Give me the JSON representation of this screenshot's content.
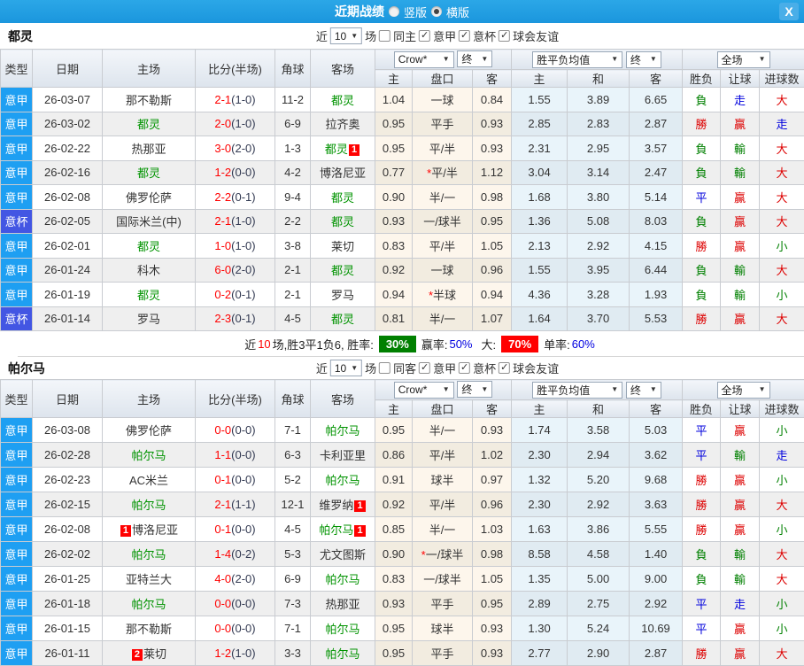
{
  "titlebar": {
    "title": "近期战绩",
    "radio_vertical": "竖版",
    "radio_horizontal": "横版"
  },
  "icons": {
    "arrow": "▼",
    "check": "✓",
    "close": "X"
  },
  "colors": {
    "titlebar_blue": "#1d9ce1",
    "league_badge": "#1e9ff2",
    "cup_badge": "#4356e3",
    "focal_team_green": "#009300",
    "score_red": "#ff0000",
    "win_red": "#dd0000",
    "draw_blue": "#0000dd",
    "lose_green": "#008000",
    "rate_green_bg": "#008000",
    "rate_red_bg": "#ff0000",
    "handicap_col_bg": "#fdf6ec",
    "avg_col_bg": "#e9f4fa"
  },
  "header_labels": {
    "type": "类型",
    "date": "日期",
    "home": "主场",
    "score": "比分(半场)",
    "corner": "角球",
    "away": "客场",
    "h": "主",
    "pan": "盘口",
    "a": "客",
    "h2": "主",
    "d": "和",
    "a2": "客",
    "result": "胜负",
    "let": "让球",
    "goals": "进球数",
    "crow": "Crow*",
    "final": "终",
    "avg": "胜平负均值",
    "final2": "终",
    "scope": "全场"
  },
  "sections": [
    {
      "team": "都灵",
      "filters": {
        "near": "近",
        "count": "10",
        "games": "场",
        "same": "同主",
        "c1": "意甲",
        "c2": "意杯",
        "c3": "球会友谊"
      },
      "rows": [
        {
          "lg": "意甲",
          "date": "26-03-07",
          "home": "那不勒斯",
          "hg": false,
          "hb": "",
          "hbp": "",
          "score": "2-1",
          "half": "(1-0)",
          "corner": "11-2",
          "away": "都灵",
          "ag": true,
          "ab": "",
          "o1": "1.04",
          "star": false,
          "pan": "一球",
          "o2": "0.84",
          "m1": "1.55",
          "m2": "3.89",
          "m3": "6.65",
          "r1": "負",
          "r2": "走",
          "r3": "大"
        },
        {
          "lg": "意甲",
          "date": "26-03-02",
          "home": "都灵",
          "hg": true,
          "hb": "",
          "hbp": "",
          "score": "2-0",
          "half": "(1-0)",
          "corner": "6-9",
          "away": "拉齐奥",
          "ag": false,
          "ab": "",
          "o1": "0.95",
          "star": false,
          "pan": "平手",
          "o2": "0.93",
          "m1": "2.85",
          "m2": "2.83",
          "m3": "2.87",
          "r1": "勝",
          "r2": "贏",
          "r3": "走"
        },
        {
          "lg": "意甲",
          "date": "26-02-22",
          "home": "热那亚",
          "hg": false,
          "hb": "",
          "hbp": "",
          "score": "3-0",
          "half": "(2-0)",
          "corner": "1-3",
          "away": "都灵",
          "ag": true,
          "ab": "1",
          "o1": "0.95",
          "star": false,
          "pan": "平/半",
          "o2": "0.93",
          "m1": "2.31",
          "m2": "2.95",
          "m3": "3.57",
          "r1": "負",
          "r2": "輸",
          "r3": "大"
        },
        {
          "lg": "意甲",
          "date": "26-02-16",
          "home": "都灵",
          "hg": true,
          "hb": "",
          "hbp": "",
          "score": "1-2",
          "half": "(0-0)",
          "corner": "4-2",
          "away": "博洛尼亚",
          "ag": false,
          "ab": "",
          "o1": "0.77",
          "star": true,
          "pan": "平/半",
          "o2": "1.12",
          "m1": "3.04",
          "m2": "3.14",
          "m3": "2.47",
          "r1": "負",
          "r2": "輸",
          "r3": "大"
        },
        {
          "lg": "意甲",
          "date": "26-02-08",
          "home": "佛罗伦萨",
          "hg": false,
          "hb": "",
          "hbp": "",
          "score": "2-2",
          "half": "(0-1)",
          "corner": "9-4",
          "away": "都灵",
          "ag": true,
          "ab": "",
          "o1": "0.90",
          "star": false,
          "pan": "半/一",
          "o2": "0.98",
          "m1": "1.68",
          "m2": "3.80",
          "m3": "5.14",
          "r1": "平",
          "r2": "贏",
          "r3": "大"
        },
        {
          "lg": "意杯",
          "date": "26-02-05",
          "home": "国际米兰(中)",
          "hg": false,
          "hb": "",
          "hbp": "",
          "score": "2-1",
          "half": "(1-0)",
          "corner": "2-2",
          "away": "都灵",
          "ag": true,
          "ab": "",
          "o1": "0.93",
          "star": false,
          "pan": "一/球半",
          "o2": "0.95",
          "m1": "1.36",
          "m2": "5.08",
          "m3": "8.03",
          "r1": "負",
          "r2": "贏",
          "r3": "大"
        },
        {
          "lg": "意甲",
          "date": "26-02-01",
          "home": "都灵",
          "hg": true,
          "hb": "",
          "hbp": "",
          "score": "1-0",
          "half": "(1-0)",
          "corner": "3-8",
          "away": "莱切",
          "ag": false,
          "ab": "",
          "o1": "0.83",
          "star": false,
          "pan": "平/半",
          "o2": "1.05",
          "m1": "2.13",
          "m2": "2.92",
          "m3": "4.15",
          "r1": "勝",
          "r2": "贏",
          "r3": "小"
        },
        {
          "lg": "意甲",
          "date": "26-01-24",
          "home": "科木",
          "hg": false,
          "hb": "",
          "hbp": "",
          "score": "6-0",
          "half": "(2-0)",
          "corner": "2-1",
          "away": "都灵",
          "ag": true,
          "ab": "",
          "o1": "0.92",
          "star": false,
          "pan": "一球",
          "o2": "0.96",
          "m1": "1.55",
          "m2": "3.95",
          "m3": "6.44",
          "r1": "負",
          "r2": "輸",
          "r3": "大"
        },
        {
          "lg": "意甲",
          "date": "26-01-19",
          "home": "都灵",
          "hg": true,
          "hb": "",
          "hbp": "",
          "score": "0-2",
          "half": "(0-1)",
          "corner": "2-1",
          "away": "罗马",
          "ag": false,
          "ab": "",
          "o1": "0.94",
          "star": true,
          "pan": "半球",
          "o2": "0.94",
          "m1": "4.36",
          "m2": "3.28",
          "m3": "1.93",
          "r1": "負",
          "r2": "輸",
          "r3": "小"
        },
        {
          "lg": "意杯",
          "date": "26-01-14",
          "home": "罗马",
          "hg": false,
          "hb": "",
          "hbp": "",
          "score": "2-3",
          "half": "(0-1)",
          "corner": "4-5",
          "away": "都灵",
          "ag": true,
          "ab": "",
          "o1": "0.81",
          "star": false,
          "pan": "半/一",
          "o2": "1.07",
          "m1": "1.64",
          "m2": "3.70",
          "m3": "5.53",
          "r1": "勝",
          "r2": "贏",
          "r3": "大"
        }
      ],
      "summary": {
        "t1": "近",
        "n1": "10",
        "t2": "场,胜3平1负6, 胜率:",
        "v1": "30%",
        "t3": "赢率:",
        "v2": "50%",
        "t4": "大:",
        "v3": "70%",
        "t5": "单率:",
        "v4": "60%"
      }
    },
    {
      "team": "帕尔马",
      "filters": {
        "near": "近",
        "count": "10",
        "games": "场",
        "same": "同客",
        "c1": "意甲",
        "c2": "意杯",
        "c3": "球会友谊"
      },
      "rows": [
        {
          "lg": "意甲",
          "date": "26-03-08",
          "home": "佛罗伦萨",
          "hg": false,
          "hb": "",
          "hbp": "",
          "score": "0-0",
          "half": "(0-0)",
          "corner": "7-1",
          "away": "帕尔马",
          "ag": true,
          "ab": "",
          "o1": "0.95",
          "star": false,
          "pan": "半/一",
          "o2": "0.93",
          "m1": "1.74",
          "m2": "3.58",
          "m3": "5.03",
          "r1": "平",
          "r2": "贏",
          "r3": "小"
        },
        {
          "lg": "意甲",
          "date": "26-02-28",
          "home": "帕尔马",
          "hg": true,
          "hb": "",
          "hbp": "",
          "score": "1-1",
          "half": "(0-0)",
          "corner": "6-3",
          "away": "卡利亚里",
          "ag": false,
          "ab": "",
          "o1": "0.86",
          "star": false,
          "pan": "平/半",
          "o2": "1.02",
          "m1": "2.30",
          "m2": "2.94",
          "m3": "3.62",
          "r1": "平",
          "r2": "輸",
          "r3": "走"
        },
        {
          "lg": "意甲",
          "date": "26-02-23",
          "home": "AC米兰",
          "hg": false,
          "hb": "",
          "hbp": "",
          "score": "0-1",
          "half": "(0-0)",
          "corner": "5-2",
          "away": "帕尔马",
          "ag": true,
          "ab": "",
          "o1": "0.91",
          "star": false,
          "pan": "球半",
          "o2": "0.97",
          "m1": "1.32",
          "m2": "5.20",
          "m3": "9.68",
          "r1": "勝",
          "r2": "贏",
          "r3": "小"
        },
        {
          "lg": "意甲",
          "date": "26-02-15",
          "home": "帕尔马",
          "hg": true,
          "hb": "",
          "hbp": "",
          "score": "2-1",
          "half": "(1-1)",
          "corner": "12-1",
          "away": "维罗纳",
          "ag": false,
          "ab": "1",
          "o1": "0.92",
          "star": false,
          "pan": "平/半",
          "o2": "0.96",
          "m1": "2.30",
          "m2": "2.92",
          "m3": "3.63",
          "r1": "勝",
          "r2": "贏",
          "r3": "大"
        },
        {
          "lg": "意甲",
          "date": "26-02-08",
          "home": "博洛尼亚",
          "hg": false,
          "hb": "1",
          "hbp": "before",
          "score": "0-1",
          "half": "(0-0)",
          "corner": "4-5",
          "away": "帕尔马",
          "ag": true,
          "ab": "1",
          "o1": "0.85",
          "star": false,
          "pan": "半/一",
          "o2": "1.03",
          "m1": "1.63",
          "m2": "3.86",
          "m3": "5.55",
          "r1": "勝",
          "r2": "贏",
          "r3": "小"
        },
        {
          "lg": "意甲",
          "date": "26-02-02",
          "home": "帕尔马",
          "hg": true,
          "hb": "",
          "hbp": "",
          "score": "1-4",
          "half": "(0-2)",
          "corner": "5-3",
          "away": "尤文图斯",
          "ag": false,
          "ab": "",
          "o1": "0.90",
          "star": true,
          "pan": "一/球半",
          "o2": "0.98",
          "m1": "8.58",
          "m2": "4.58",
          "m3": "1.40",
          "r1": "負",
          "r2": "輸",
          "r3": "大"
        },
        {
          "lg": "意甲",
          "date": "26-01-25",
          "home": "亚特兰大",
          "hg": false,
          "hb": "",
          "hbp": "",
          "score": "4-0",
          "half": "(2-0)",
          "corner": "6-9",
          "away": "帕尔马",
          "ag": true,
          "ab": "",
          "o1": "0.83",
          "star": false,
          "pan": "一/球半",
          "o2": "1.05",
          "m1": "1.35",
          "m2": "5.00",
          "m3": "9.00",
          "r1": "負",
          "r2": "輸",
          "r3": "大"
        },
        {
          "lg": "意甲",
          "date": "26-01-18",
          "home": "帕尔马",
          "hg": true,
          "hb": "",
          "hbp": "",
          "score": "0-0",
          "half": "(0-0)",
          "corner": "7-3",
          "away": "热那亚",
          "ag": false,
          "ab": "",
          "o1": "0.93",
          "star": false,
          "pan": "平手",
          "o2": "0.95",
          "m1": "2.89",
          "m2": "2.75",
          "m3": "2.92",
          "r1": "平",
          "r2": "走",
          "r3": "小"
        },
        {
          "lg": "意甲",
          "date": "26-01-15",
          "home": "那不勒斯",
          "hg": false,
          "hb": "",
          "hbp": "",
          "score": "0-0",
          "half": "(0-0)",
          "corner": "7-1",
          "away": "帕尔马",
          "ag": true,
          "ab": "",
          "o1": "0.95",
          "star": false,
          "pan": "球半",
          "o2": "0.93",
          "m1": "1.30",
          "m2": "5.24",
          "m3": "10.69",
          "r1": "平",
          "r2": "贏",
          "r3": "小"
        },
        {
          "lg": "意甲",
          "date": "26-01-11",
          "home": "莱切",
          "hg": false,
          "hb": "2",
          "hbp": "before",
          "score": "1-2",
          "half": "(1-0)",
          "corner": "3-3",
          "away": "帕尔马",
          "ag": true,
          "ab": "",
          "o1": "0.95",
          "star": false,
          "pan": "平手",
          "o2": "0.93",
          "m1": "2.77",
          "m2": "2.90",
          "m3": "2.87",
          "r1": "勝",
          "r2": "贏",
          "r3": "大"
        }
      ]
    }
  ]
}
